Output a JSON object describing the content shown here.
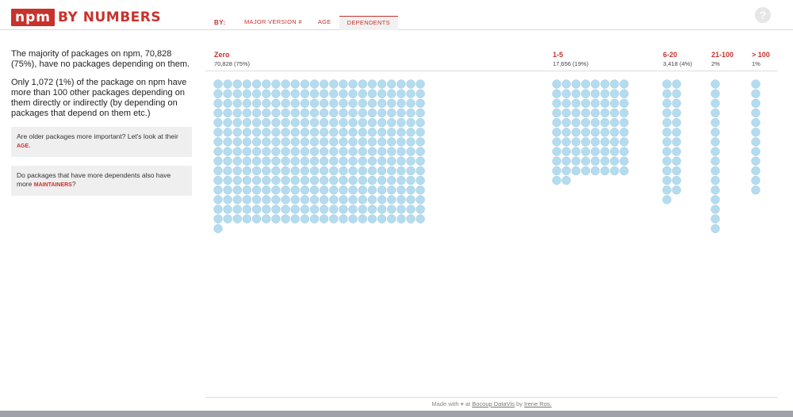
{
  "header": {
    "logo_npm": "npm",
    "logo_text": "BY NUMBERS",
    "by_label": "BY:",
    "tabs": [
      {
        "label": "MAJOR VERSION #",
        "active": false
      },
      {
        "label": "AGE",
        "active": false
      },
      {
        "label": "DEPENDENTS",
        "active": true
      }
    ],
    "help_icon": "question-mark-icon",
    "help_glyph": "?"
  },
  "left": {
    "para1": "The majority of packages on npm, 70,828 (75%), have no packages depending on them.",
    "para2": "Only 1,072 (1%) of the package on npm have more than 100 other packages depending on them directly or indirectly (by depending on packages that depend on them etc.)",
    "callout1": {
      "text": "Are older packages more important? Let's look at their",
      "link": "age",
      "end": "."
    },
    "callout2": {
      "text": "Do packages that have more dependents also have more",
      "link": "maintainers",
      "end": "?"
    }
  },
  "chart_data": {
    "type": "unit-dot",
    "groups": [
      {
        "label": "Zero",
        "count_label": "70,828 (75%)",
        "count": 70828,
        "percent": 75,
        "dots": 331
      },
      {
        "label": "1-5",
        "count_label": "17,656 (19%)",
        "count": 17656,
        "percent": 19,
        "dots": 82
      },
      {
        "label": "6-20",
        "count_label": "3,418 (4%)",
        "count": 3418,
        "percent": 4,
        "dots": 25
      },
      {
        "label": "21-100",
        "count_label": "2%",
        "percent": 2,
        "dots": 16
      },
      {
        "label": "> 100",
        "count_label": "1%",
        "percent": 1,
        "dots": 12
      }
    ],
    "dot_color": "#b5dcee",
    "dot_stroke": "#9ccbe2",
    "label_color": "#c8322d"
  },
  "footer": {
    "made_with": "Made with",
    "heart": "♥",
    "at": "at",
    "bocoup": "Bocoup DataVis",
    "by": "by",
    "author": "Irene Ros."
  },
  "colors": {
    "accent": "#c8322d",
    "panel_bg": "#efefef"
  }
}
